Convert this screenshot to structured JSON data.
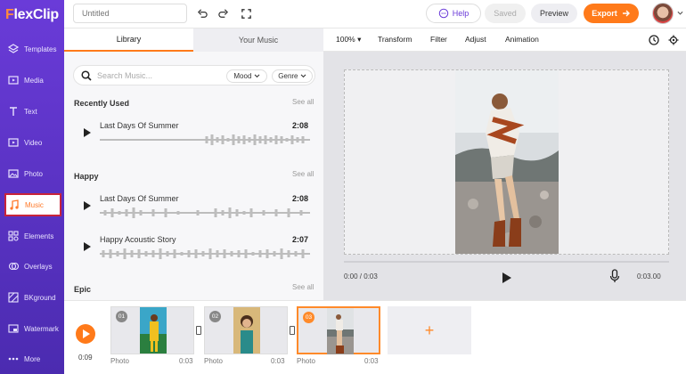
{
  "app": {
    "logo_pre": "F",
    "logo_rest": "lexClip"
  },
  "sidebar": {
    "items": [
      {
        "label": "Templates",
        "icon": "layers-icon"
      },
      {
        "label": "Media",
        "icon": "media-icon"
      },
      {
        "label": "Text",
        "icon": "text-icon"
      },
      {
        "label": "Video",
        "icon": "video-icon"
      },
      {
        "label": "Photo",
        "icon": "photo-icon"
      },
      {
        "label": "Music",
        "icon": "music-icon"
      },
      {
        "label": "Elements",
        "icon": "elements-icon"
      },
      {
        "label": "Overlays",
        "icon": "overlays-icon"
      },
      {
        "label": "BKground",
        "icon": "background-icon"
      },
      {
        "label": "Watermark",
        "icon": "watermark-icon"
      },
      {
        "label": "More",
        "icon": "more-icon"
      }
    ],
    "active": "Music"
  },
  "topbar": {
    "title_placeholder": "Untitled",
    "help": "Help",
    "saved": "Saved",
    "preview": "Preview",
    "export": "Export"
  },
  "panel": {
    "tabs": [
      "Library",
      "Your Music"
    ],
    "search_placeholder": "Search Music...",
    "mood": "Mood",
    "genre": "Genre",
    "sections": [
      {
        "title": "Recently Used",
        "see_all": "See all",
        "tracks": [
          {
            "name": "Last Days Of Summer",
            "duration": "2:08"
          }
        ]
      },
      {
        "title": "Happy",
        "see_all": "See all",
        "tracks": [
          {
            "name": "Last Days Of Summer",
            "duration": "2:08"
          },
          {
            "name": "Happy Acoustic Story",
            "duration": "2:07"
          }
        ]
      },
      {
        "title": "Epic",
        "see_all": "See all",
        "tracks": []
      }
    ]
  },
  "editor": {
    "zoom": "100%",
    "tools": [
      "Transform",
      "Filter",
      "Adjust",
      "Animation"
    ],
    "time_current": "0:00 / 0:03",
    "time_total": "0:03.00"
  },
  "timeline": {
    "time": "0:09",
    "clips": [
      {
        "num": "01",
        "label": "Photo",
        "duration": "0:03"
      },
      {
        "num": "02",
        "label": "Photo",
        "duration": "0:03"
      },
      {
        "num": "03",
        "label": "Photo",
        "duration": "0:03"
      }
    ]
  },
  "colors": {
    "accent": "#ff7a1a",
    "sidebar": "#5a33c4",
    "active_border": "#c8243a"
  }
}
